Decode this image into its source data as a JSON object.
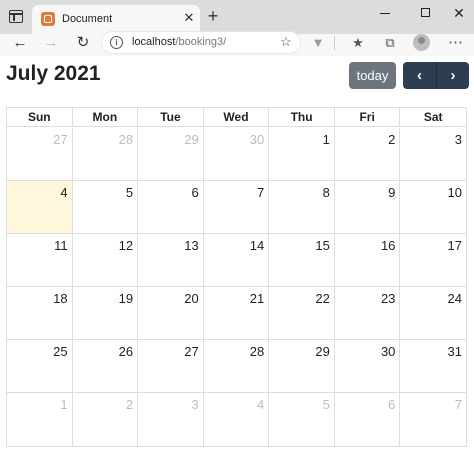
{
  "browser": {
    "tab_title": "Document",
    "tab_close": "✕",
    "new_tab": "+",
    "url_host": "localhost",
    "url_path": "/booking3/",
    "win_close": "✕"
  },
  "calendar": {
    "title": "July 2021",
    "today_label": "today",
    "prev_label": "‹",
    "next_label": "›",
    "weekdays": [
      "Sun",
      "Mon",
      "Tue",
      "Wed",
      "Thu",
      "Fri",
      "Sat"
    ],
    "weeks": [
      [
        {
          "d": "27",
          "other": true
        },
        {
          "d": "28",
          "other": true
        },
        {
          "d": "29",
          "other": true
        },
        {
          "d": "30",
          "other": true
        },
        {
          "d": "1",
          "other": false
        },
        {
          "d": "2",
          "other": false
        },
        {
          "d": "3",
          "other": false
        }
      ],
      [
        {
          "d": "4",
          "other": false,
          "today": true
        },
        {
          "d": "5",
          "other": false
        },
        {
          "d": "6",
          "other": false
        },
        {
          "d": "7",
          "other": false
        },
        {
          "d": "8",
          "other": false
        },
        {
          "d": "9",
          "other": false
        },
        {
          "d": "10",
          "other": false
        }
      ],
      [
        {
          "d": "11",
          "other": false
        },
        {
          "d": "12",
          "other": false
        },
        {
          "d": "13",
          "other": false
        },
        {
          "d": "14",
          "other": false
        },
        {
          "d": "15",
          "other": false
        },
        {
          "d": "16",
          "other": false
        },
        {
          "d": "17",
          "other": false
        }
      ],
      [
        {
          "d": "18",
          "other": false
        },
        {
          "d": "19",
          "other": false
        },
        {
          "d": "20",
          "other": false
        },
        {
          "d": "21",
          "other": false
        },
        {
          "d": "22",
          "other": false
        },
        {
          "d": "23",
          "other": false
        },
        {
          "d": "24",
          "other": false
        }
      ],
      [
        {
          "d": "25",
          "other": false
        },
        {
          "d": "26",
          "other": false
        },
        {
          "d": "27",
          "other": false
        },
        {
          "d": "28",
          "other": false
        },
        {
          "d": "29",
          "other": false
        },
        {
          "d": "30",
          "other": false
        },
        {
          "d": "31",
          "other": false
        }
      ],
      [
        {
          "d": "1",
          "other": true
        },
        {
          "d": "2",
          "other": true
        },
        {
          "d": "3",
          "other": true
        },
        {
          "d": "4",
          "other": true
        },
        {
          "d": "5",
          "other": true
        },
        {
          "d": "6",
          "other": true
        },
        {
          "d": "7",
          "other": true
        }
      ]
    ]
  },
  "colors": {
    "today_button": "#6c757d",
    "nav_buttons": "#2c3e50",
    "today_highlight": "#fff8dc"
  }
}
